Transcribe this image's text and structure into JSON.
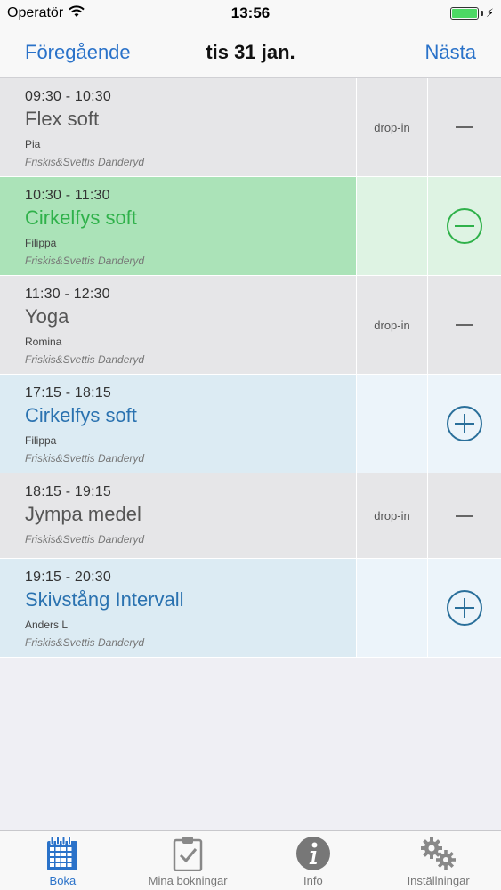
{
  "status_bar": {
    "carrier": "Operatör",
    "time": "13:56",
    "battery_color": "#4cd964"
  },
  "nav": {
    "prev_label": "Föregående",
    "title": "tis 31 jan.",
    "next_label": "Nästa",
    "accent_color": "#2a72c9"
  },
  "sessions": [
    {
      "time_start": "09:30",
      "time_sep": " - ",
      "time_end": "10:30",
      "name": "Flex soft",
      "instructor": "Pia",
      "location": "Friskis&Svettis Danderyd",
      "mid_label": "drop-in",
      "state": "gray",
      "action_icon": "dash-icon"
    },
    {
      "time_start": "10:30",
      "time_sep": " - ",
      "time_end": "11:30",
      "name": "Cirkelfys soft",
      "instructor": "Filippa",
      "location": "Friskis&Svettis Danderyd",
      "mid_label": "",
      "state": "green",
      "action_icon": "minus-circle-icon"
    },
    {
      "time_start": "11:30",
      "time_sep": " - ",
      "time_end": "12:30",
      "name": "Yoga",
      "instructor": "Romina",
      "location": "Friskis&Svettis Danderyd",
      "mid_label": "drop-in",
      "state": "gray",
      "action_icon": "dash-icon"
    },
    {
      "time_start": "17:15",
      "time_sep": " - ",
      "time_end": "18:15",
      "name": "Cirkelfys soft",
      "instructor": "Filippa",
      "location": "Friskis&Svettis Danderyd",
      "mid_label": "",
      "state": "blue",
      "action_icon": "plus-circle-icon"
    },
    {
      "time_start": "18:15",
      "time_sep": " - ",
      "time_end": "19:15",
      "name": "Jympa medel",
      "instructor": "",
      "location": "Friskis&Svettis Danderyd",
      "mid_label": "drop-in",
      "state": "gray",
      "action_icon": "dash-icon"
    },
    {
      "time_start": "19:15",
      "time_sep": " - ",
      "time_end": "20:30",
      "name": "Skivstång Intervall",
      "instructor": "Anders L",
      "location": "Friskis&Svettis Danderyd",
      "mid_label": "",
      "state": "blue",
      "action_icon": "plus-circle-icon"
    }
  ],
  "tabs": [
    {
      "label": "Boka",
      "icon": "calendar-icon",
      "active": true
    },
    {
      "label": "Mina bokningar",
      "icon": "clipboard-check-icon",
      "active": false
    },
    {
      "label": "Info",
      "icon": "info-icon",
      "active": false
    },
    {
      "label": "Inställningar",
      "icon": "gears-icon",
      "active": false
    }
  ]
}
